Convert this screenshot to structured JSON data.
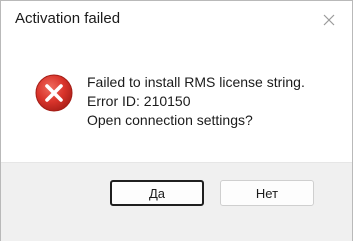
{
  "window": {
    "title": "Activation failed",
    "close_icon": "close-icon"
  },
  "message": {
    "icon": "error-icon",
    "lines": [
      "Failed to install RMS license string.",
      "Error ID: 210150",
      "Open connection settings?"
    ]
  },
  "buttons": {
    "yes_label": "Да",
    "no_label": "Нет"
  },
  "colors": {
    "error_red": "#d9342b",
    "footer_bg": "#f0f0f0"
  }
}
